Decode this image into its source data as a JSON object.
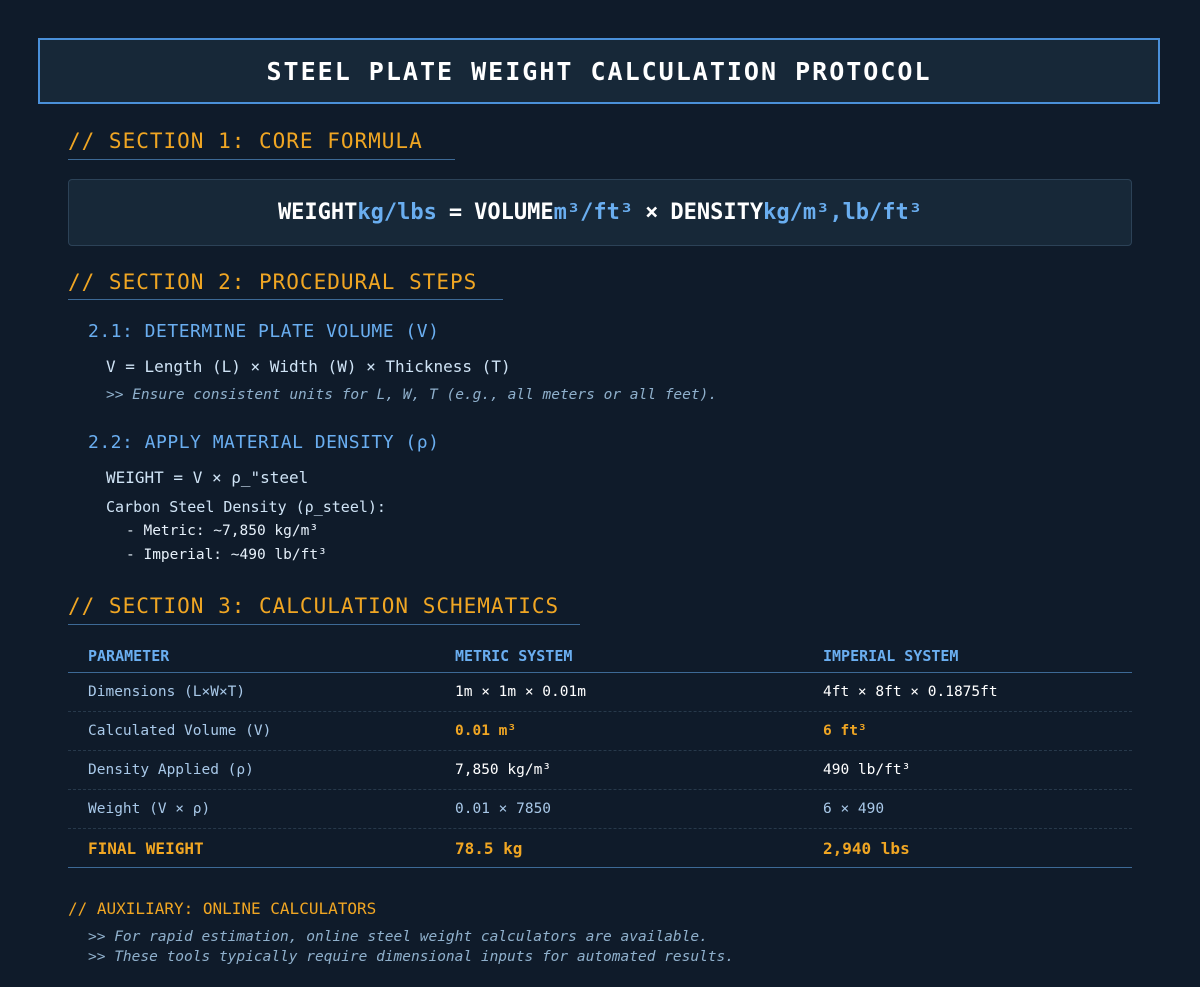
{
  "title": "STEEL PLATE WEIGHT CALCULATION PROTOCOL",
  "section1": {
    "heading": "// SECTION 1: CORE FORMULA",
    "formula": {
      "weight": "WEIGHT",
      "weight_unit": "kg/lbs",
      "equals": "=",
      "volume": "VOLUME",
      "volume_unit": "m³/ft³",
      "times": "×",
      "density": "DENSITY",
      "density_unit": "kg/m³,lb/ft³"
    }
  },
  "section2": {
    "heading": "// SECTION 2: PROCEDURAL STEPS",
    "step1": {
      "title": "2.1: DETERMINE PLATE VOLUME (V)",
      "equation": "V = Length (L) × Width (W) × Thickness (T)",
      "note": ">> Ensure consistent units for L, W, T (e.g., all meters or all feet)."
    },
    "step2": {
      "title": "2.2: APPLY MATERIAL DENSITY (ρ)",
      "equation": "WEIGHT = V × ρ_\"steel",
      "density_label": "Carbon Steel Density (ρ_steel):",
      "items": [
        "- Metric: ~7,850 kg/m³",
        "- Imperial: ~490 lb/ft³"
      ]
    }
  },
  "section3": {
    "heading": "// SECTION 3: CALCULATION SCHEMATICS",
    "table": {
      "headers": [
        "PARAMETER",
        "METRIC SYSTEM",
        "IMPERIAL SYSTEM"
      ],
      "rows": [
        [
          "Dimensions (L×W×T)",
          "1m × 1m × 0.01m",
          "4ft × 8ft × 0.1875ft"
        ],
        [
          "Calculated Volume (V)",
          "0.01 m³",
          "6 ft³"
        ],
        [
          "Density Applied (ρ)",
          "7,850 kg/m³",
          "490 lb/ft³"
        ],
        [
          "Weight (V × ρ)",
          "0.01 × 7850",
          "6 × 490"
        ],
        [
          "FINAL WEIGHT",
          "78.5 kg",
          "2,940 lbs"
        ]
      ]
    }
  },
  "auxiliary": {
    "heading": "// AUXILIARY: ONLINE CALCULATORS",
    "lines": [
      ">> For rapid estimation, online steel weight calculators are available.",
      ">> These tools typically require dimensional inputs for automated results."
    ]
  },
  "colors": {
    "background": "#0f1b2a",
    "accent_orange": "#f0a623",
    "accent_blue": "#6aaef0",
    "title_border": "#4a90d9"
  }
}
